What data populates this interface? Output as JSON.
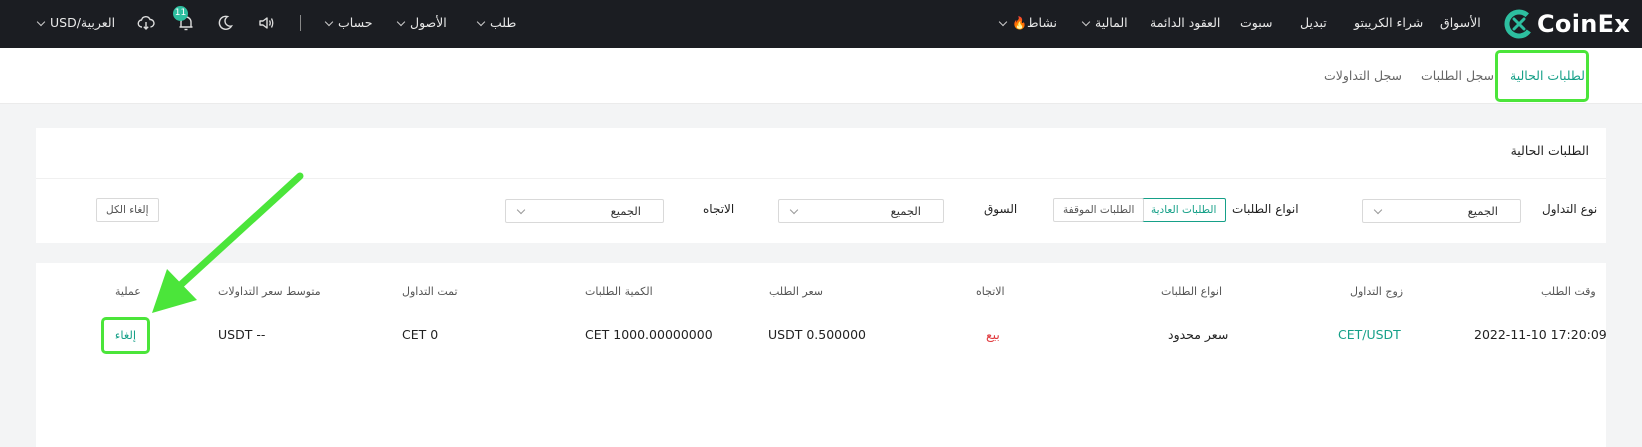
{
  "nav": {
    "brand": "CoinEx",
    "items": {
      "markets": "الأسواق",
      "buy_crypto": "شراء الكريبتو",
      "swap": "تبديل",
      "spot": "سبوت",
      "futures": "العقود الدائمة",
      "finance": "المالية",
      "activity": "نشاط",
      "orders": "طلب",
      "assets": "الأصول",
      "account": "حساب"
    },
    "activity_icon": "🔥",
    "notification_count": "11",
    "language_currency": "USD/العربية"
  },
  "tabs": {
    "current_orders": "الطلبات الحالية",
    "order_history": "سجل الطلبات",
    "trade_history": "سجل التداولات"
  },
  "filters": {
    "section_title": "الطلبات الحالية",
    "trade_type_label": "نوع التداول",
    "trade_type_value": "الجميع",
    "order_types_label": "انواع الطلبات",
    "normal_orders": "الطلبات العادية",
    "stop_orders": "الطلبات الموقفة",
    "market_label": "السوق",
    "market_value": "الجميع",
    "direction_label": "الاتجاه",
    "direction_value": "الجميع",
    "cancel_all": "إلغاء الكل"
  },
  "table": {
    "headers": {
      "order_time": "وقت الطلب",
      "pair": "زوج التداول",
      "order_type": "انواع الطلبات",
      "direction": "الاتجاه",
      "price": "سعر الطلب",
      "amount": "الكمية الطلبات",
      "executed": "تمت التداول",
      "avg_price": "متوسط سعر التداولات",
      "action": "عملية"
    },
    "rows": [
      {
        "order_time": "2022-11-10 17:20:09",
        "pair": "CET/USDT",
        "order_type": "سعر محدود",
        "direction": "بيع",
        "price": "0.500000 USDT",
        "amount": "1000.00000000 CET",
        "executed": "0 CET",
        "avg_price": "-- USDT",
        "action": "إلغاء"
      }
    ]
  },
  "colors": {
    "accent": "#16a088",
    "sell": "#e0393e",
    "highlight": "#4be53a",
    "nav_bg": "#1b1d22"
  }
}
